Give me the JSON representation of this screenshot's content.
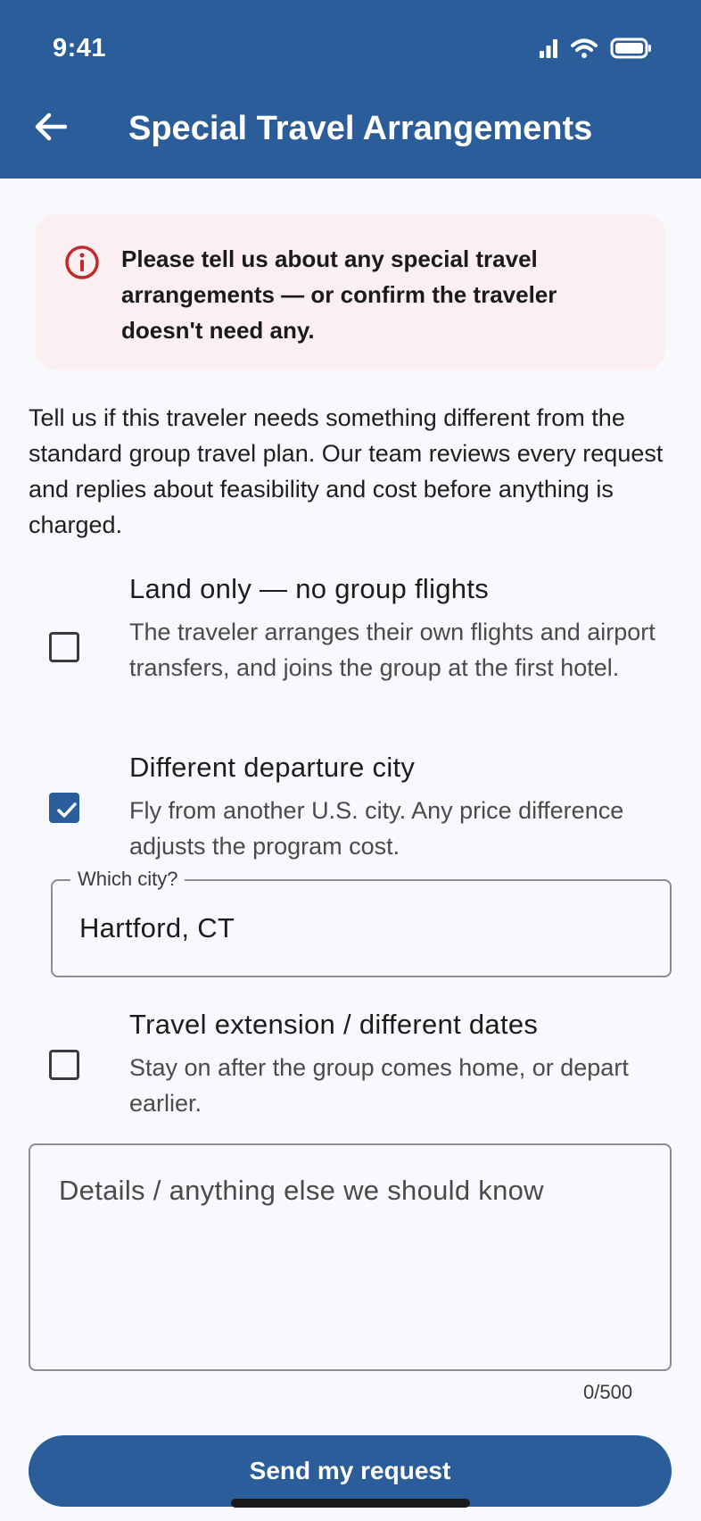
{
  "status_bar": {
    "time": "9:41",
    "icons": [
      "cellular-signal-icon",
      "wifi-icon",
      "battery-icon"
    ]
  },
  "header": {
    "title": "Special Travel Arrangements",
    "back_icon": "arrow-back-icon"
  },
  "alert": {
    "icon": "info-circle-icon",
    "message": "Please tell us about any special travel arrangements — or confirm the traveler doesn't need any."
  },
  "intro": "Tell us if this traveler needs something different from the standard group travel plan. Our team reviews every request and replies about feasibility and cost before anything is charged.",
  "options": [
    {
      "title": "Land only — no group flights",
      "description": "The traveler arranges their own flights and airport transfers, and joins the group at the first hotel.",
      "checked": false
    },
    {
      "title": "Different departure city",
      "description": "Fly from another U.S. city. Any price difference adjusts the program cost.",
      "checked": true
    },
    {
      "title": "Travel extension / different dates",
      "description": "Stay on after the group comes home, or depart earlier.",
      "checked": false
    }
  ],
  "city_field": {
    "label": "Which city?",
    "value": "Hartford, CT"
  },
  "details": {
    "placeholder": "Details / anything else we should know",
    "counter": "0/500"
  },
  "submit_label": "Send my request",
  "colors": {
    "primary": "#2c5d9b",
    "alert_bg": "#fbeff1",
    "alert_icon": "#c62828"
  }
}
